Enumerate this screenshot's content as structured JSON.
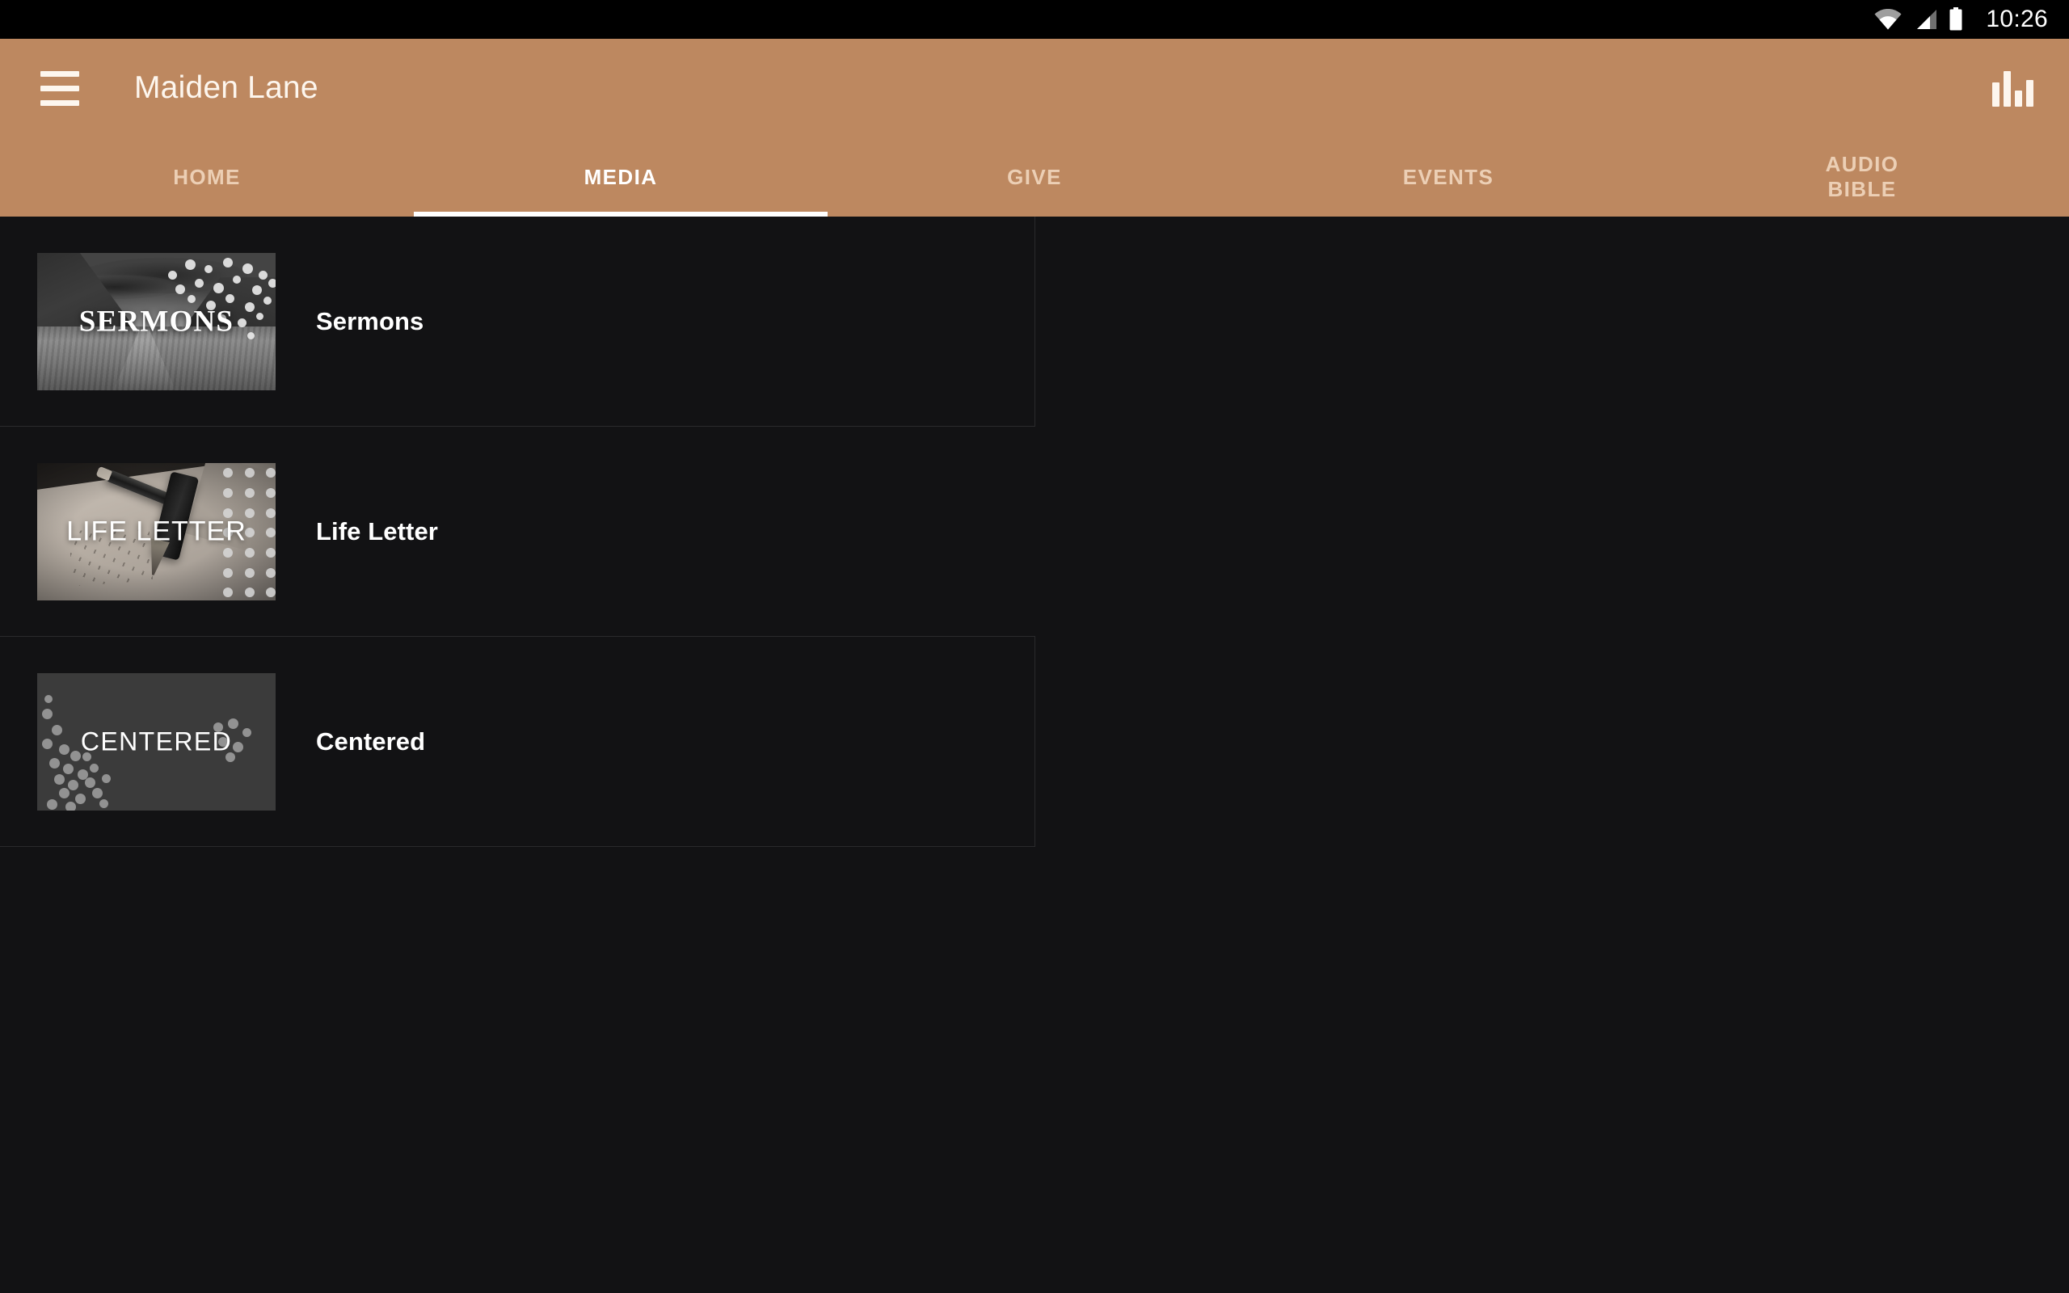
{
  "status_bar": {
    "time": "10:26",
    "icons": [
      "wifi-icon",
      "cellular-signal-icon",
      "battery-icon"
    ]
  },
  "app_bar": {
    "menu_icon": "hamburger-menu-icon",
    "title": "Maiden Lane",
    "action_icon": "bar-chart-icon",
    "background_color": "#bd8860",
    "text_color": "#fdf6ee"
  },
  "tabs": {
    "active_index": 1,
    "active_indicator_color": "#ffffff",
    "inactive_color": "#eccfb5",
    "items": [
      {
        "label": "HOME"
      },
      {
        "label": "MEDIA"
      },
      {
        "label": "GIVE"
      },
      {
        "label": "EVENTS"
      },
      {
        "label": "AUDIO\nBIBLE"
      }
    ]
  },
  "media": {
    "background_color": "#121214",
    "divider_color": "#2a2a2c",
    "items": [
      {
        "label": "Sermons",
        "thumbnail_caption": "SERMONS",
        "thumbnail_art": "grayscale-mountain-valley-photo"
      },
      {
        "label": "Life Letter",
        "thumbnail_caption": "LIFE LETTER",
        "thumbnail_art": "pens-on-handwritten-paper-photo"
      },
      {
        "label": "Centered",
        "thumbnail_caption": "CENTERED",
        "thumbnail_art": "dark-gray-with-scattered-dots"
      }
    ]
  }
}
